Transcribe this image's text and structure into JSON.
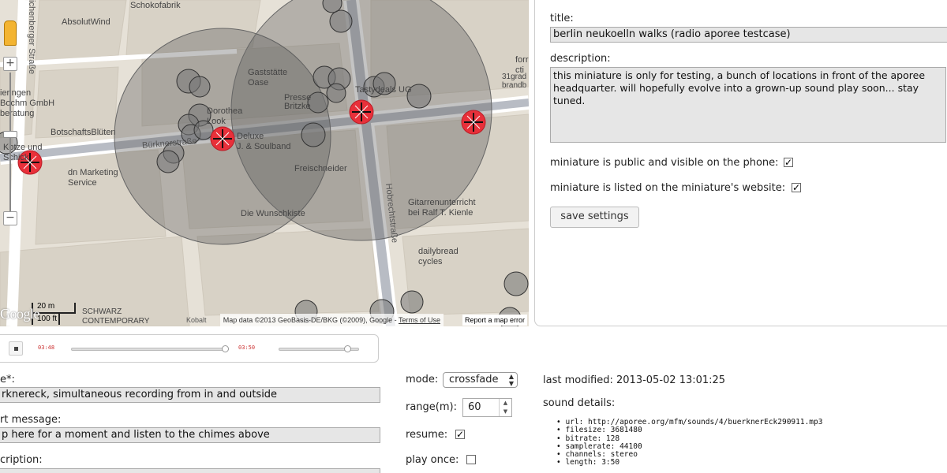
{
  "map": {
    "labels": {
      "street_left_vertical": "ichenberger Straße",
      "schokofabrik": "Schokofabrik",
      "absolutwind": "AbsolutWind",
      "gaststaette": "Gaststätte\nOase",
      "presse": "Presse\nBritzke",
      "tasty": "Tastydeals UG",
      "dorothea": "Dorothea\nLook",
      "deluxe": "Deluxe\nJ. & Soulband",
      "buerkner": "Bürknerstraße",
      "botschaft": "BotschaftsBlüten",
      "ieringen": "ieringen\nBochm GmbH\nberatung",
      "kotze": "Kotze und\nSchick",
      "marketing": "dn Marketing\nService",
      "freischneider": "Freischneider",
      "wunschkiste": "Die Wunschkiste",
      "hobrecht": "Hobrechtstraße",
      "gitarren": "Gitarrenunterricht\nbei Ralf T. Kienle",
      "dailybread": "dailybread\ncycles",
      "forr": "forr\ncti",
      "grad": "31grad\nbrandb",
      "schwarz": "SCHWARZ\nCONTEMPORARY",
      "kobalt": "Kobalt"
    },
    "scale": {
      "metric": "20 m",
      "imperial": "100 ft"
    },
    "logo": "Google",
    "attribution": "Map data ©2013 GeoBasis-DE/BKG (©2009), Google - ",
    "terms": "Terms of Use",
    "report": "Report a map error",
    "zoom_in": "+",
    "zoom_out": "−"
  },
  "settings": {
    "title_label": "title:",
    "title_value": "berlin neukoelln walks (radio aporee testcase)",
    "description_label": "description:",
    "description_value": "this miniature is only for testing, a bunch of locations in front of the aporee headquarter. will hopefully evolve into a grown-up sound play soon... stay tuned.",
    "public_label": "miniature is public and visible on the phone:",
    "public_checked": "✓",
    "listed_label": "miniature is listed on the miniature's website:",
    "listed_checked": "✓",
    "save_label": "save settings"
  },
  "player": {
    "time_current": "03:48",
    "time_total": "03:50",
    "progress": 0.99,
    "volume": 0.85
  },
  "sound": {
    "name_label": "e*:",
    "name_value": "rknereck, simultaneous recording from in and outside",
    "start_label": "rt message:",
    "start_value": "p here for a moment and listen to the chimes above",
    "desc_label": "cription:",
    "mode_label": "mode:",
    "mode_value": "crossfade",
    "range_label": "range(m):",
    "range_value": "60",
    "resume_label": "resume:",
    "resume_checked": "✓",
    "playonce_label": "play once:",
    "playonce_checked": "",
    "last_modified": "last modified: 2013-05-02 13:01:25",
    "details_label": "sound details:",
    "details": [
      "url: http://aporee.org/mfm/sounds/4/buerknerEck290911.mp3",
      "filesize: 3681480",
      "bitrate: 128",
      "samplerate: 44100",
      "channels: stereo",
      "length: 3:50"
    ]
  },
  "colors": {
    "circle_fill": "#555555",
    "marker_red": "#e8303a",
    "road": "#ffffff",
    "block": "#d6d0c4"
  }
}
